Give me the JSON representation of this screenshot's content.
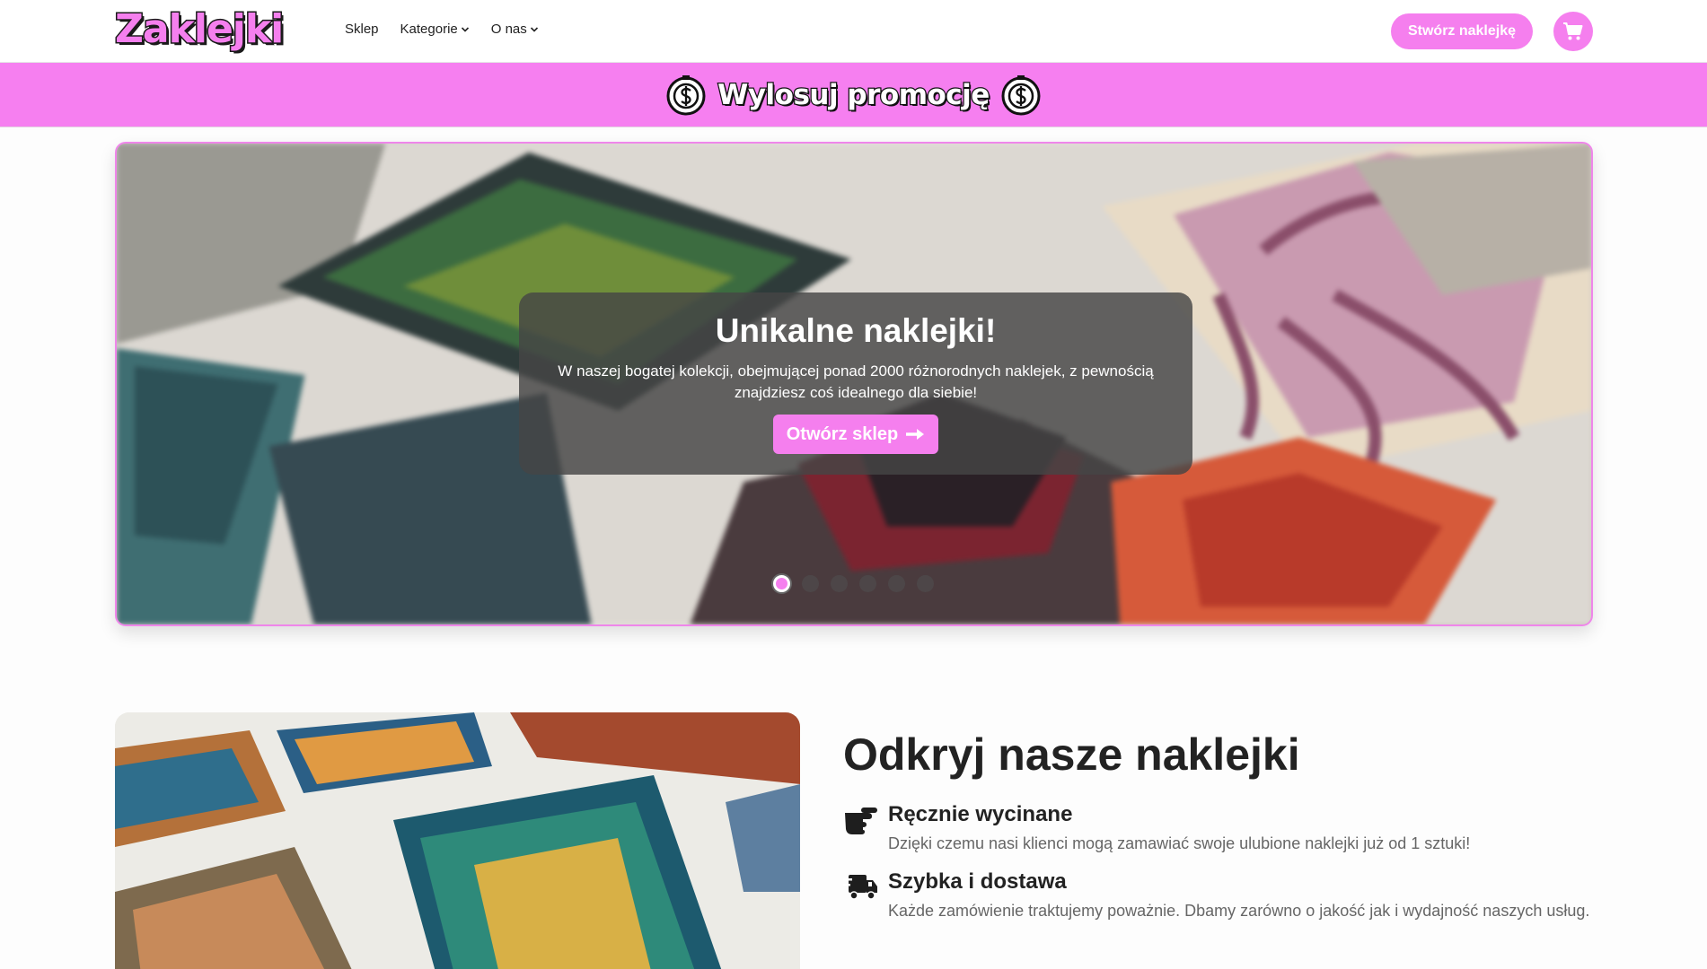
{
  "header": {
    "logo_text": "Zaklejki",
    "nav": [
      {
        "label": "Sklep",
        "has_dropdown": false
      },
      {
        "label": "Kategorie",
        "has_dropdown": true
      },
      {
        "label": "O nas",
        "has_dropdown": true
      }
    ],
    "cta_label": "Stwórz naklejkę",
    "cart_icon": "cart-icon"
  },
  "promo": {
    "label": "Wylosuj promocję",
    "icon": "dollar-coin-icon"
  },
  "hero": {
    "title": "Unikalne naklejki!",
    "text": "W naszej bogatej kolekcji, obejmującej ponad 2000 różnorodnych naklejek, z pewnością znajdziesz coś idealnego dla siebie!",
    "button_label": "Otwórz sklep",
    "button_icon": "arrow-right-icon",
    "slides_count": 6,
    "active_slide": 1
  },
  "section": {
    "title": "Odkryj nasze naklejki",
    "features": [
      {
        "icon": "hand-scissors-icon",
        "title": "Ręcznie wycinane",
        "text": "Dzięki czemu nasi klienci mogą zamawiać swoje ulubione naklejki już od 1 sztuki!"
      },
      {
        "icon": "truck-fast-icon",
        "title": "Szybka i dostawa",
        "text": "Każde zamówienie traktujemy poważnie. Dbamy zarówno o jakość jak i wydajność naszych usług."
      }
    ]
  },
  "colors": {
    "accent": "#f57fee",
    "promo_bg": "#f67ff0",
    "overlay_bg": "#464646"
  }
}
